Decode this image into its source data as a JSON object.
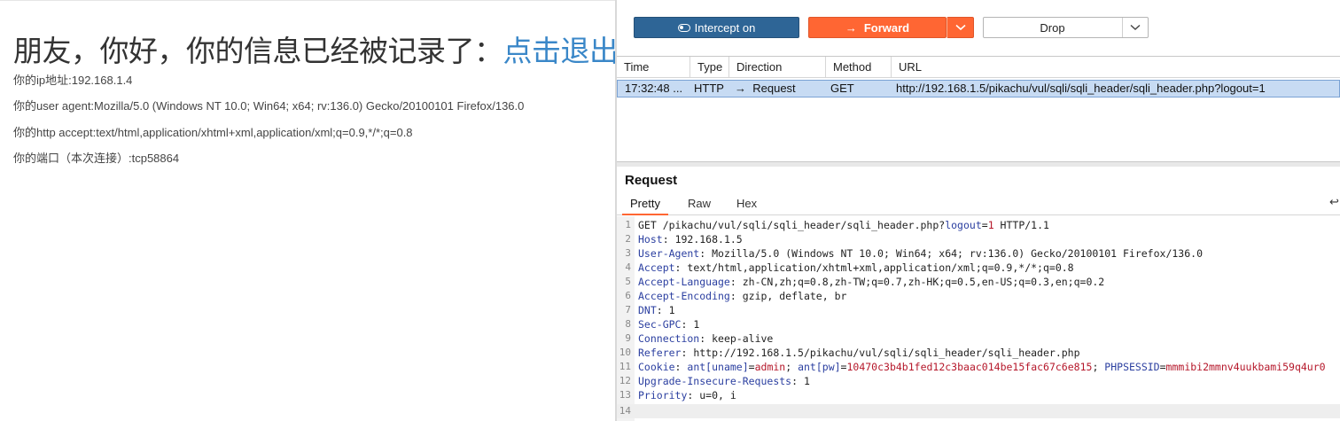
{
  "page": {
    "headline_text": "朋友，你好，你的信息已经被记录了：",
    "headline_link": "点击退出",
    "info_lines": [
      "你的ip地址:192.168.1.4",
      "你的user agent:Mozilla/5.0 (Windows NT 10.0; Win64; x64; rv:136.0) Gecko/20100101 Firefox/136.0",
      "你的http accept:text/html,application/xhtml+xml,application/xml;q=0.9,*/*;q=0.8",
      "你的端口（本次连接）:tcp58864"
    ]
  },
  "proxy": {
    "toolbar": {
      "intercept_label": "Intercept on",
      "forward_label": "Forward",
      "drop_label": "Drop"
    },
    "table": {
      "headers": [
        "Time",
        "Type",
        "Direction",
        "Method",
        "URL"
      ],
      "row": {
        "time": "17:32:48 ...",
        "type": "HTTP",
        "direction": "Request",
        "method": "GET",
        "url": "http://192.168.1.5/pikachu/vul/sqli/sqli_header/sqli_header.php?logout=1"
      }
    },
    "request": {
      "title": "Request",
      "tabs": [
        "Pretty",
        "Raw",
        "Hex"
      ],
      "line_numbers": [
        "1",
        "2",
        "3",
        "4",
        "5",
        "6",
        "7",
        "8",
        "9",
        "10",
        "11",
        "12",
        "13",
        "14"
      ],
      "l1_method": "GET",
      "l1_path": " /pikachu/vul/sqli/sqli_header/sqli_header.php?",
      "l1_param": "logout",
      "l1_eq": "=",
      "l1_val": "1",
      "l1_proto": " HTTP/1.1",
      "headers": [
        {
          "name": "Host",
          "value": " 192.168.1.5"
        },
        {
          "name": "User-Agent",
          "value": " Mozilla/5.0 (Windows NT 10.0; Win64; x64; rv:136.0) Gecko/20100101 Firefox/136.0"
        },
        {
          "name": "Accept",
          "value": " text/html,application/xhtml+xml,application/xml;q=0.9,*/*;q=0.8"
        },
        {
          "name": "Accept-Language",
          "value": " zh-CN,zh;q=0.8,zh-TW;q=0.7,zh-HK;q=0.5,en-US;q=0.3,en;q=0.2"
        },
        {
          "name": "Accept-Encoding",
          "value": " gzip, deflate, br"
        },
        {
          "name": "DNT",
          "value": " 1"
        },
        {
          "name": "Sec-GPC",
          "value": " 1"
        },
        {
          "name": "Connection",
          "value": " keep-alive"
        },
        {
          "name": "Referer",
          "value": " http://192.168.1.5/pikachu/vul/sqli/sqli_header/sqli_header.php"
        }
      ],
      "cookie": {
        "name": "Cookie",
        "c1_key": "ant[uname]",
        "c1_val": "admin",
        "c2_key": "ant[pw]",
        "c2_val": "10470c3b4b1fed12c3baac014be15fac67c6e815",
        "c3_key": "PHPSESSID",
        "c3_val": "mmmibi2mmnv4uukbami59q4ur0"
      },
      "headers_after": [
        {
          "name": "Upgrade-Insecure-Requests",
          "value": " 1"
        },
        {
          "name": "Priority",
          "value": " u=0, i"
        }
      ]
    }
  }
}
